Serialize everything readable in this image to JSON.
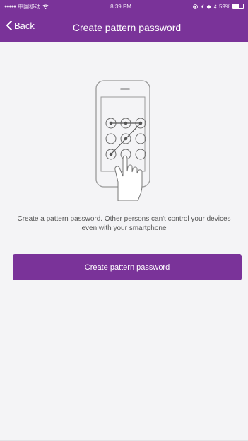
{
  "status_bar": {
    "signal_dots": "●●●●●",
    "carrier": "中国移动",
    "time": "8:39 PM",
    "battery_percent": "59%"
  },
  "nav": {
    "back_label": "Back",
    "title": "Create pattern password"
  },
  "description": "Create a pattern password. Other persons can't control your devices even with your smartphone",
  "create_button_label": "Create pattern password",
  "colors": {
    "accent": "#7a3399",
    "background": "#f4f4f6"
  }
}
